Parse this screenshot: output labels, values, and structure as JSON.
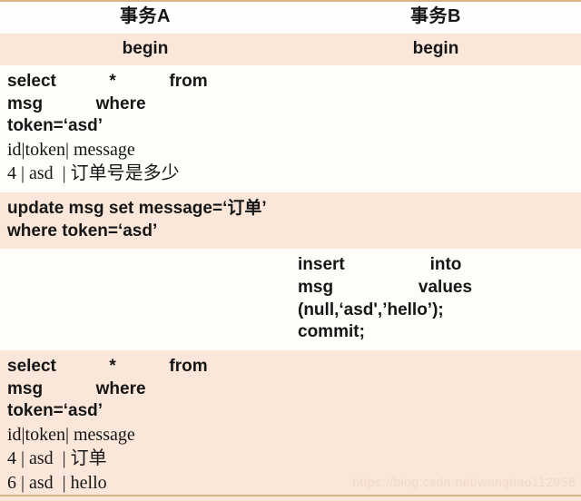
{
  "table": {
    "columns": [
      {
        "id": "a",
        "header": "事务A"
      },
      {
        "id": "b",
        "header": "事务B"
      }
    ],
    "rows": [
      {
        "id": "begin-row",
        "tint": true,
        "a": {
          "kind": "centered",
          "text": "begin"
        },
        "b": {
          "kind": "centered",
          "text": "begin"
        }
      },
      {
        "id": "select-1-row",
        "tint": false,
        "a": {
          "kind": "sql",
          "lines": [
            {
              "text": "select  *  from  msg  where",
              "style": "sql-stretch-wide"
            },
            {
              "text": "token=‘asd’",
              "style": "sql"
            },
            {
              "text": "id|token| message",
              "style": "result"
            },
            {
              "text": "4 | asd  | 订单号是多少",
              "style": "result"
            }
          ]
        },
        "b": {
          "kind": "empty"
        }
      },
      {
        "id": "update-row",
        "tint": true,
        "a": {
          "kind": "sql",
          "lines": [
            {
              "text": "update msg set message=‘订单’",
              "style": "sql"
            },
            {
              "text": "where token=‘asd’",
              "style": "sql"
            }
          ]
        },
        "b": {
          "kind": "empty"
        }
      },
      {
        "id": "insert-row",
        "tint": false,
        "a": {
          "kind": "empty"
        },
        "b": {
          "kind": "sql",
          "lines": [
            {
              "text": "insert   into   msg   values",
              "style": "sql-stretch-mid"
            },
            {
              "text": "(null,‘asd',’hello’);",
              "style": "sql"
            },
            {
              "text": "commit;",
              "style": "sql"
            }
          ]
        }
      },
      {
        "id": "select-2-row",
        "tint": true,
        "a": {
          "kind": "sql",
          "lines": [
            {
              "text": "select  *  from  msg  where",
              "style": "sql-stretch-wide"
            },
            {
              "text": "token=‘asd’",
              "style": "sql"
            },
            {
              "text": "id|token| message",
              "style": "result"
            },
            {
              "text": "4 | asd  | 订单",
              "style": "result"
            },
            {
              "text": "6 | asd  | hello",
              "style": "result"
            }
          ]
        },
        "b": {
          "kind": "empty"
        }
      }
    ]
  },
  "watermark": {
    "text": "https://blog.csdn.net/wanghao112956"
  },
  "colors": {
    "rule": "#d8b487",
    "tint_row": "#fae7d9",
    "light_row": "#fffdf9",
    "text": "#161616",
    "watermark": "#f0d9c8"
  }
}
